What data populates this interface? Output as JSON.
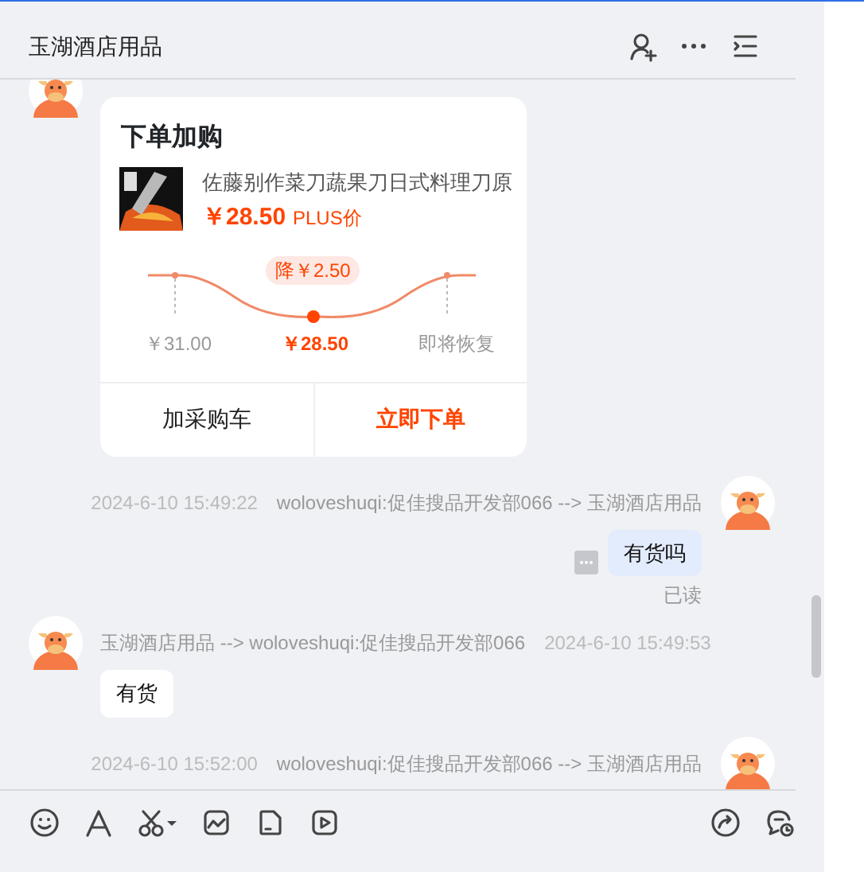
{
  "window": {
    "title": "玉湖酒店用品"
  },
  "messages": [
    {
      "kind": "order-card",
      "outgoing": false,
      "card": {
        "title": "下单加购",
        "product": "佐藤别作菜刀蔬果刀日式料理刀原",
        "price": "￥28.50",
        "price_tag": "PLUS价",
        "drop": "降￥2.50",
        "points": [
          "￥31.00",
          "￥28.50",
          "即将恢复"
        ],
        "buttons": [
          {
            "label": "加采购车",
            "primary": false
          },
          {
            "label": "立即下单",
            "primary": true
          }
        ]
      }
    },
    {
      "kind": "text",
      "outgoing": true,
      "time": "2024-6-10 15:49:22",
      "route": "woloveshuqi:促佳搜品开发部066 --> 玉湖酒店用品",
      "text": "有货吗",
      "status": "已读"
    },
    {
      "kind": "text",
      "outgoing": false,
      "route": "玉湖酒店用品 --> woloveshuqi:促佳搜品开发部066",
      "time": "2024-6-10 15:49:53",
      "text": "有货"
    },
    {
      "kind": "header",
      "outgoing": true,
      "time": "2024-6-10 15:52:00",
      "route": "woloveshuqi:促佳搜品开发部066 --> 玉湖酒店用品"
    }
  ]
}
